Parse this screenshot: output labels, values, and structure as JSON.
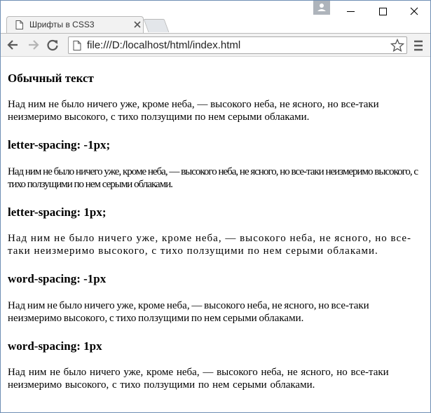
{
  "tab": {
    "title": "Шрифты в CSS3"
  },
  "toolbar": {
    "url": "file:///D:/localhost/html/index.html"
  },
  "content": {
    "sections": [
      {
        "heading": "Обычный текст",
        "text": "Над ним не было ничего уже, кроме неба, — высокого неба, не ясного, но все-таки неизмеримо высокого, с тихо ползущими по нем серыми облаками."
      },
      {
        "heading": "letter-spacing: -1px;",
        "text": "Над ним не было ничего уже, кроме неба, — высокого неба, не ясного, но все-таки неизмеримо высокого, с тихо ползущими по нем серыми облаками."
      },
      {
        "heading": "letter-spacing: 1px;",
        "text": "Над ним не было ничего уже, кроме неба, — высокого неба, не ясного, но все-таки неизмеримо высокого, с тихо ползущими по нем серыми облаками."
      },
      {
        "heading": "word-spacing: -1px",
        "text": "Над ним не было ничего уже, кроме неба, — высокого неба, не ясного, но все-таки неизмеримо высокого, с тихо ползущими по нем серыми облаками."
      },
      {
        "heading": "word-spacing: 1px",
        "text": "Над ним не было ничего уже, кроме неба, — высокого неба, не ясного, но все-таки неизмеримо высокого, с тихо ползущими по нем серыми облаками."
      }
    ]
  },
  "icons": {
    "tab_page": "page-icon",
    "tab_close": "close-icon",
    "back": "arrow-left-icon",
    "forward": "arrow-right-icon",
    "reload": "reload-icon",
    "omnibox_page": "page-icon",
    "bookmark": "star-icon",
    "menu": "hamburger-menu-icon",
    "profile": "user-icon",
    "minimize": "minimize-icon",
    "maximize": "maximize-icon",
    "close_window": "close-icon"
  },
  "colors": {
    "window_border": "#6f8fb4",
    "toolbar_bg": "#f2f2f2",
    "tab_bg": "#f2f2f2"
  }
}
